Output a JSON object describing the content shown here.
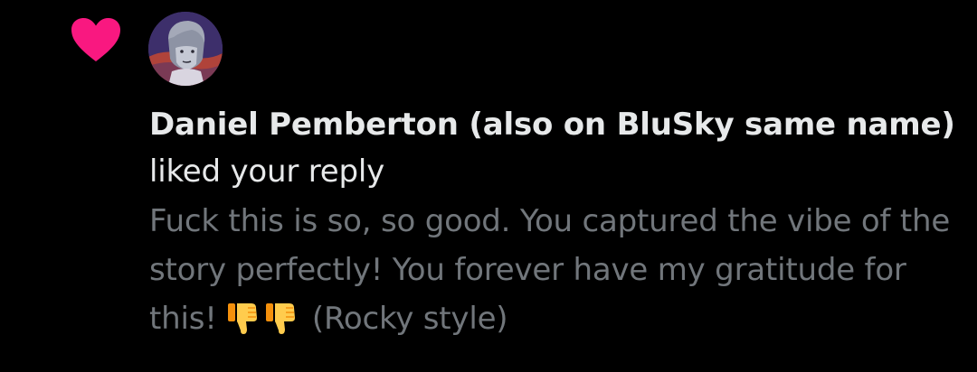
{
  "notification": {
    "type_icon": "heart-icon",
    "accent_color": "#f91880",
    "avatar_icon": "avatar-illustration",
    "user_name": "Daniel Pemberton (also on BluSky same name)",
    "action_text": "liked your reply",
    "reply": {
      "text_before_emoji": "Fuck this is so, so good. You captured the vibe of the story perfectly! You forever have my gratitude for this!",
      "emoji": [
        "thumbs-down-emoji",
        "thumbs-down-emoji"
      ],
      "text_after_emoji": "(Rocky style)"
    }
  }
}
